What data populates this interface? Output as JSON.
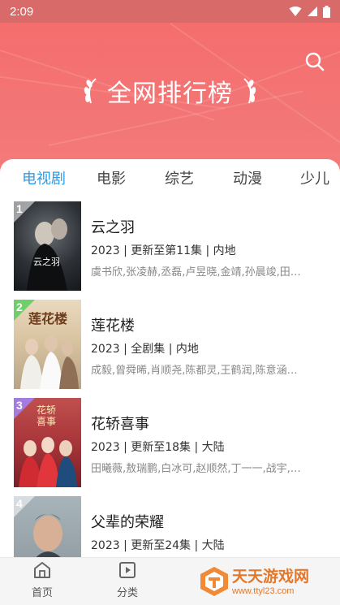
{
  "status_bar": {
    "time": "2:09"
  },
  "hero": {
    "title": "全网排行榜"
  },
  "tabs": [
    {
      "label": "电视剧",
      "active": true
    },
    {
      "label": "电影",
      "active": false
    },
    {
      "label": "综艺",
      "active": false
    },
    {
      "label": "动漫",
      "active": false
    },
    {
      "label": "少儿",
      "active": false
    }
  ],
  "items": [
    {
      "rank": "1",
      "title": "云之羽",
      "meta": "2023 | 更新至第11集 | 内地",
      "cast": "虞书欣,张凌赫,丞磊,卢昱晓,金靖,孙晨竣,田…",
      "poster_text": "云之羽"
    },
    {
      "rank": "2",
      "title": "莲花楼",
      "meta": "2023 | 全剧集 | 内地",
      "cast": "成毅,曾舜晞,肖顺尧,陈都灵,王鹤润,陈意涵…",
      "poster_text": "莲花楼"
    },
    {
      "rank": "3",
      "title": "花轿喜事",
      "meta": "2023 | 更新至18集 | 大陆",
      "cast": "田曦薇,敖瑞鹏,白冰可,赵顺然,丁一一,战宇,…",
      "poster_text": "花轿喜事"
    },
    {
      "rank": "4",
      "title": "父辈的荣耀",
      "meta": "2023 | 更新至24集 | 大陆",
      "cast": "",
      "poster_text": ""
    }
  ],
  "bottom_nav": [
    {
      "label": "首页",
      "icon": "home-icon"
    },
    {
      "label": "分类",
      "icon": "category-icon"
    }
  ],
  "watermark": {
    "text": "天天游戏网",
    "url": "www.ttyl23.com"
  },
  "colors": {
    "hero": "#f56e6e",
    "tab_active": "#2b9de6",
    "watermark": "#e3782a"
  }
}
